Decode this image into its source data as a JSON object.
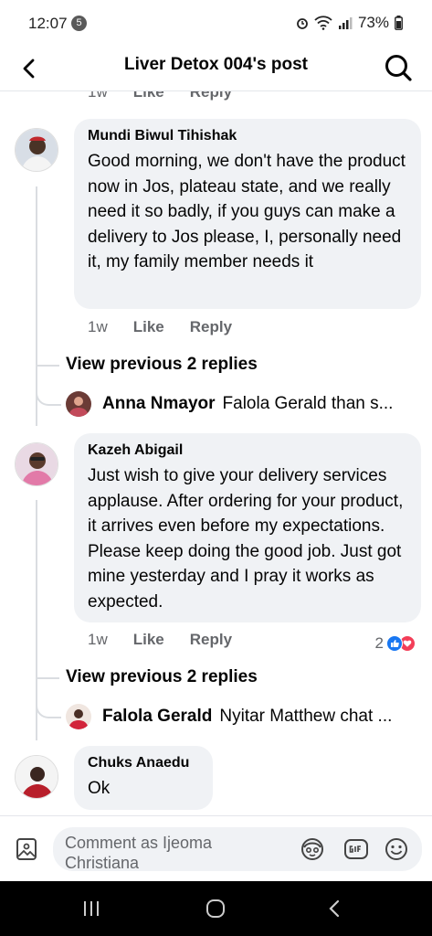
{
  "status_bar": {
    "time": "12:07",
    "notification_count": "5",
    "battery": "73%"
  },
  "header": {
    "title": "Liver Detox 004's post"
  },
  "prev_meta": {
    "time": "1w",
    "like": "Like",
    "reply": "Reply"
  },
  "comments": [
    {
      "author": "Mundi Biwul Tihishak",
      "text": "Good morning, we don't have the product now in Jos, plateau state, and we really need it so badly, if you guys can make a delivery to Jos please, I, personally need it, my family member needs it",
      "time": "1w",
      "like": "Like",
      "reply": "Reply",
      "view_replies": "View previous 2 replies",
      "latest_reply": {
        "author": "Anna Nmayor",
        "text": "Falola Gerald than s..."
      }
    },
    {
      "author": "Kazeh Abigail",
      "text": "Just wish to give your delivery services applause. After ordering for your product, it arrives even before my expectations. Please keep doing the good job. Just got mine yesterday and I pray it works as expected.",
      "time": "1w",
      "like": "Like",
      "reply": "Reply",
      "reaction_count": "2",
      "view_replies": "View previous 2 replies",
      "latest_reply": {
        "author": "Falola Gerald",
        "text": "Nyitar Matthew chat ..."
      }
    },
    {
      "author": "Chuks Anaedu",
      "text": "Ok"
    }
  ],
  "composer": {
    "placeholder": "Comment as Ijeoma Christiana"
  },
  "colors": {
    "bubble_bg": "#f0f2f5",
    "like_blue": "#1877f2",
    "love_red": "#f33e58",
    "muted_text": "#65676b"
  }
}
